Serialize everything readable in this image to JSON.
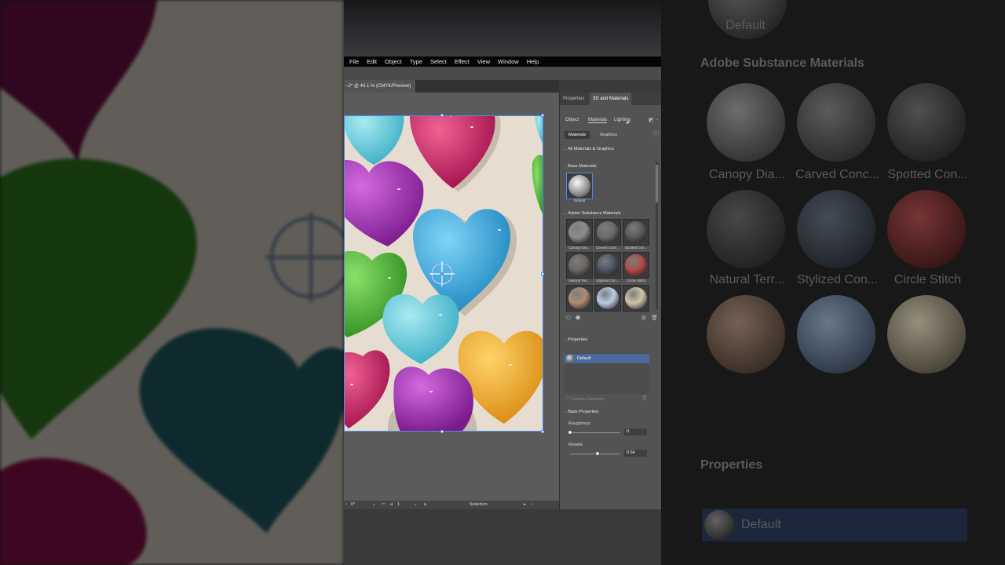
{
  "menu": [
    "File",
    "Edit",
    "Object",
    "Type",
    "Select",
    "Effect",
    "View",
    "Window",
    "Help"
  ],
  "document": {
    "tab_title": "~2* @ 44.1 % (CMYK/Preview)"
  },
  "status": {
    "rotation": "0°",
    "artboard": "1",
    "tool": "Selection"
  },
  "panel": {
    "tabs": [
      "Properties",
      "3D and Materials"
    ],
    "segments": [
      "Object",
      "Materials",
      "Lighting"
    ],
    "subtabs": [
      "Materials",
      "Graphics"
    ],
    "all_section": "All Materials & Graphics",
    "base_section": "Base Materials",
    "base_default_label": "Default",
    "substance_section": "Adobe Substance Materials",
    "materials": [
      {
        "label": "Canopy Dia...",
        "color": "#8c8c8c"
      },
      {
        "label": "Carved Conc...",
        "color": "#6b6b6b"
      },
      {
        "label": "Spotted Con...",
        "color": "#595959"
      },
      {
        "label": "Natural Terr...",
        "color": "#6a6764"
      },
      {
        "label": "Stylized Con...",
        "color": "#4d5563"
      },
      {
        "label": "Circle Stitch",
        "color": "#b34a4a"
      },
      {
        "label": "",
        "color": "#b08a74"
      },
      {
        "label": "",
        "color": "#b9cce3"
      },
      {
        "label": "",
        "color": "#cfc4a8"
      }
    ],
    "properties_section": "Properties",
    "property_item": "Default",
    "invisible_geometry": "Invisible Geometry",
    "base_properties_section": "Base Properties",
    "roughness_label": "Roughness",
    "roughness_value": "0",
    "roughness_level": 0,
    "metallic_label": "Metallic",
    "metallic_value": "0.54",
    "metallic_level": 0.54
  },
  "bg_right": {
    "default_label": "Default",
    "section": "Adobe Substance Materials",
    "labels": [
      "Canopy Dia...",
      "Carved Conc...",
      "Spotted Con...",
      "Natural Terr...",
      "Stylized Con...",
      "Circle Stitch"
    ],
    "properties": "Properties",
    "property_item": "Default"
  },
  "colors": {
    "magenta": "#c2185b",
    "purple": "#9c27b0",
    "cyan": "#4fc3e0",
    "sky": "#3aa7dc",
    "green": "#4caf3a",
    "orange": "#f0a830",
    "teal": "#2e7d8c",
    "selection": "#4c8df0"
  }
}
